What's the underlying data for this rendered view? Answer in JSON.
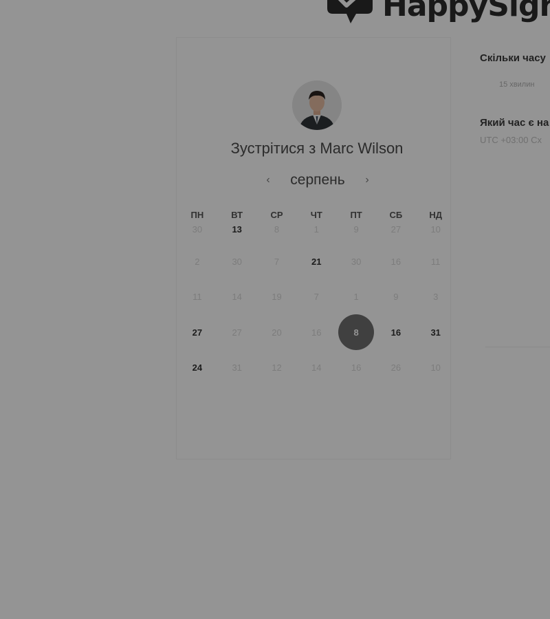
{
  "brand": {
    "name": "HappySign"
  },
  "title_prefix": "Зустрітися з",
  "host_name": "Marc Wilson",
  "calendar": {
    "month": "серпень",
    "prev": "‹",
    "next": "›",
    "weekdays": [
      "ПН",
      "ВТ",
      "СР",
      "ЧТ",
      "ПТ",
      "СБ",
      "НД"
    ],
    "weeks": [
      [
        {
          "d": "30",
          "s": "dim"
        },
        {
          "d": "13",
          "s": "avail"
        },
        {
          "d": "8",
          "s": "dim"
        },
        {
          "d": "1",
          "s": "dim"
        },
        {
          "d": "9",
          "s": "dim"
        },
        {
          "d": "27",
          "s": "dim"
        },
        {
          "d": "10",
          "s": "dim"
        }
      ],
      [
        {
          "d": "2",
          "s": "dim"
        },
        {
          "d": "30",
          "s": "dim"
        },
        {
          "d": "7",
          "s": "dim"
        },
        {
          "d": "21",
          "s": "avail"
        },
        {
          "d": "30",
          "s": "dim"
        },
        {
          "d": "16",
          "s": "dim"
        },
        {
          "d": "11",
          "s": "dim"
        }
      ],
      [
        {
          "d": "11",
          "s": "dim"
        },
        {
          "d": "14",
          "s": "dim"
        },
        {
          "d": "19",
          "s": "dim"
        },
        {
          "d": "7",
          "s": "dim"
        },
        {
          "d": "1",
          "s": "dim"
        },
        {
          "d": "9",
          "s": "dim"
        },
        {
          "d": "3",
          "s": "dim"
        }
      ],
      [
        {
          "d": "27",
          "s": "avail"
        },
        {
          "d": "27",
          "s": "dim"
        },
        {
          "d": "20",
          "s": "dim"
        },
        {
          "d": "16",
          "s": "dim"
        },
        {
          "d": "8",
          "s": "sel"
        },
        {
          "d": "16",
          "s": "avail"
        },
        {
          "d": "31",
          "s": "avail"
        }
      ],
      [
        {
          "d": "24",
          "s": "avail"
        },
        {
          "d": "31",
          "s": "dim"
        },
        {
          "d": "12",
          "s": "dim"
        },
        {
          "d": "14",
          "s": "dim"
        },
        {
          "d": "16",
          "s": "dim"
        },
        {
          "d": "26",
          "s": "dim"
        },
        {
          "d": "10",
          "s": "dim"
        }
      ]
    ]
  },
  "right": {
    "duration_question": "Скільки часу",
    "duration_value": "15 хвилин",
    "time_question": "Який час є на",
    "timezone": "UTC +03:00 Сх"
  },
  "colors": {
    "overlay": "rgba(0,0,0,0.42)",
    "selected": "#6e6e6e",
    "text": "#4a4a4a"
  }
}
